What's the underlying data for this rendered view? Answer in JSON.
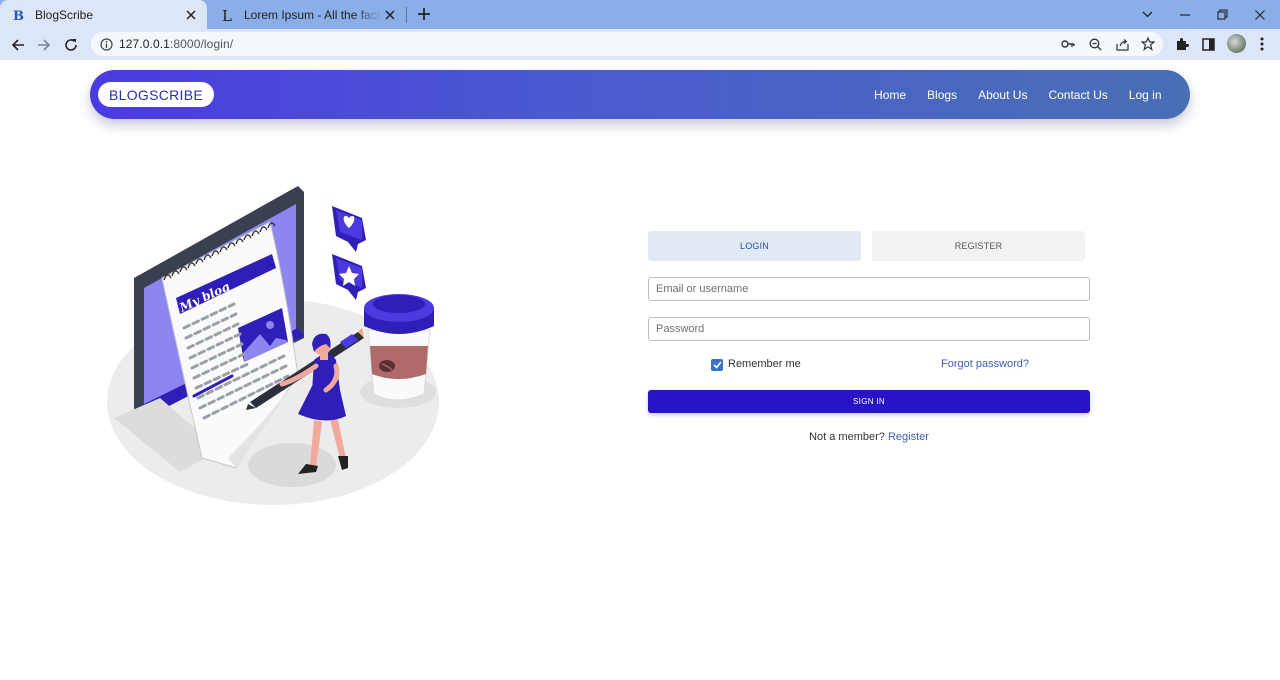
{
  "browser": {
    "tabs": [
      {
        "title": "BlogScribe",
        "favicon": "B"
      },
      {
        "title": "Lorem Ipsum - All the facts - Lipsum",
        "favicon": "L"
      }
    ],
    "url_host": "127.0.0.1",
    "url_rest": ":8000/login/"
  },
  "site": {
    "brand": "BLOGSCRIBE",
    "nav": [
      "Home",
      "Blogs",
      "About Us",
      "Contact Us",
      "Log in"
    ]
  },
  "illustration": {
    "caption": "My blog"
  },
  "form": {
    "tab_login": "LOGIN",
    "tab_register": "REGISTER",
    "email_placeholder": "Email or username",
    "password_placeholder": "Password",
    "remember": "Remember me",
    "remember_checked": true,
    "forgot": "Forgot password?",
    "signin": "SIGN IN",
    "not_member": "Not a member?",
    "register_link": "Register"
  },
  "colors": {
    "navbar_start": "#4b3ae0",
    "navbar_end": "#4a6fb4",
    "primary_button": "#2714c4",
    "link": "#3b5fb0"
  }
}
